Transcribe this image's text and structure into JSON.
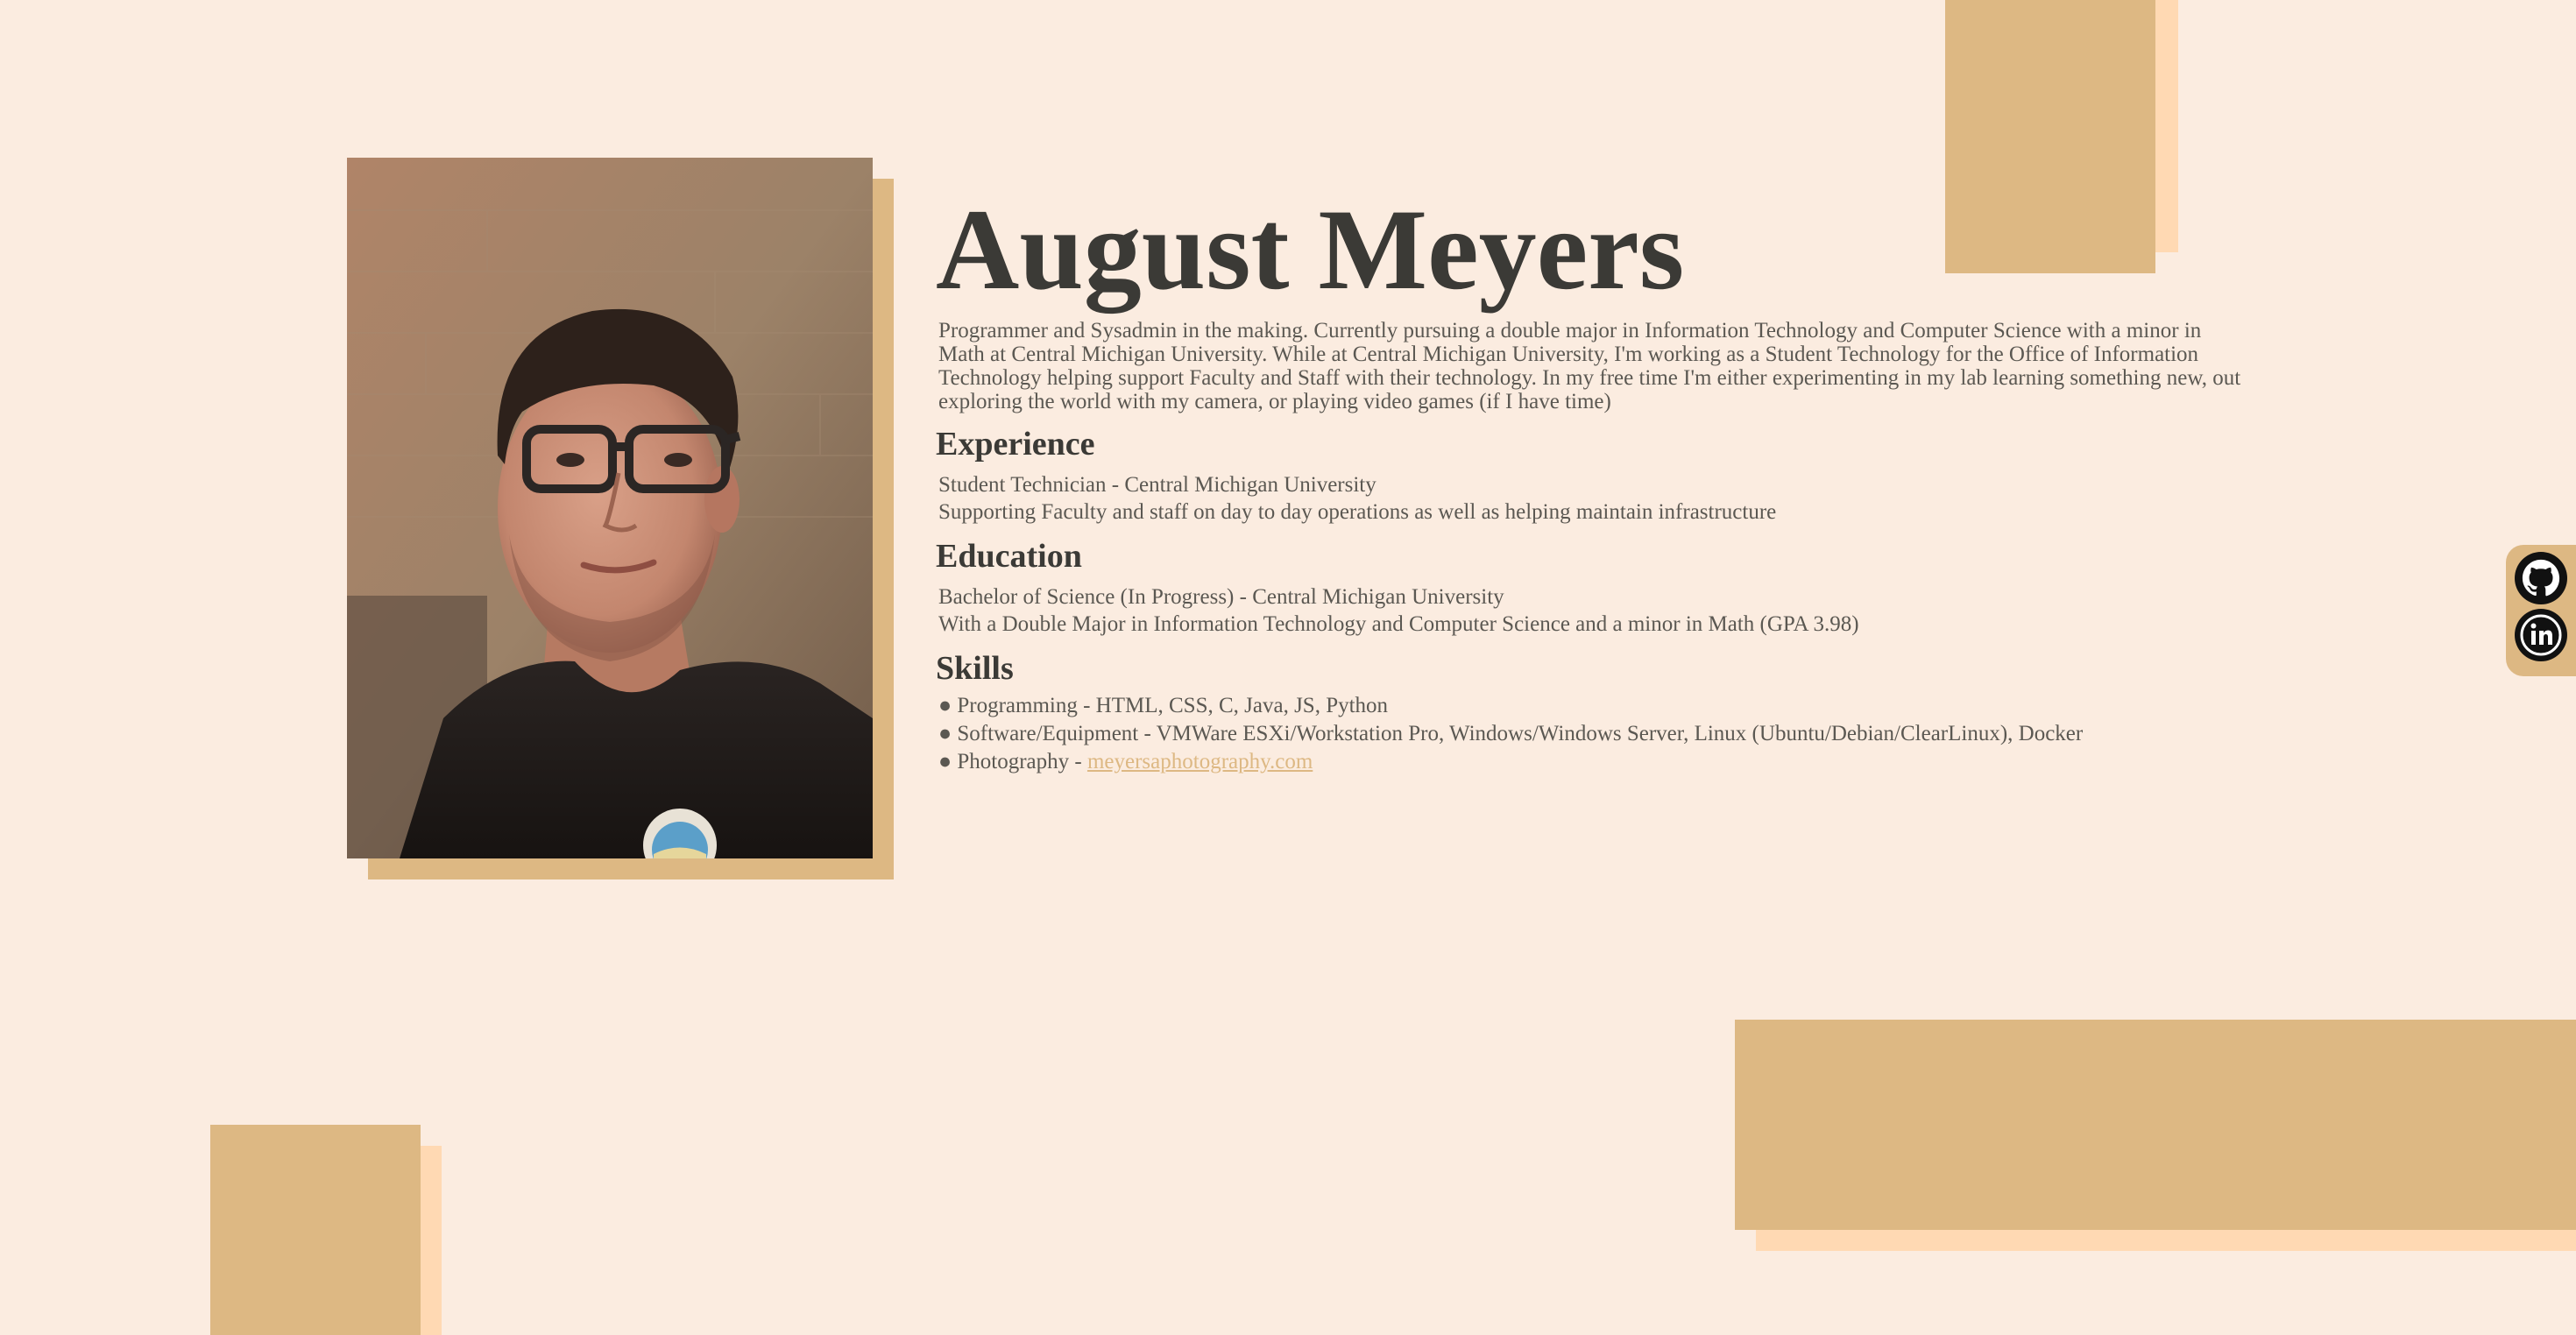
{
  "profile": {
    "name": "August Meyers",
    "bio": "Programmer and Sysadmin in the making. Currently pursuing a double major in Information Technology and Computer Science with a minor in Math at Central Michigan University. While at Central Michigan University, I'm working as a Student Technology for the Office of Information Technology helping support Faculty and Staff with their technology. In my free time I'm either experimenting in my lab learning something new, out exploring the world with my camera, or playing video games (if I have time)"
  },
  "experience": {
    "heading": "Experience",
    "title": "Student Technician - Central Michigan University",
    "description": "Supporting Faculty and staff on day to day operations as well as helping maintain infrastructure"
  },
  "education": {
    "heading": "Education",
    "title": "Bachelor of Science (In Progress) - Central Michigan University",
    "description": "With a Double Major in Information Technology and Computer Science and a minor in Math (GPA 3.98)"
  },
  "skills": {
    "heading": "Skills",
    "bullet": "●",
    "items": [
      {
        "text": "Programming - HTML, CSS, C, Java, JS, Python"
      },
      {
        "text": "Software/Equipment - VMWare ESXi/Workstation Pro, Windows/Windows Server, Linux (Ubuntu/Debian/ClearLinux), Docker"
      },
      {
        "text": "Photography - ",
        "link": "meyersaphotography.com"
      }
    ]
  },
  "social": {
    "github_icon": "github-icon",
    "linkedin_icon": "linkedin-icon"
  },
  "colors": {
    "background": "#fbece0",
    "accent_tan": "#ddb883",
    "accent_peach": "#ffd9b3",
    "text_dark": "#3b3a36",
    "text_body": "#5b5852",
    "link": "#ddb883"
  }
}
